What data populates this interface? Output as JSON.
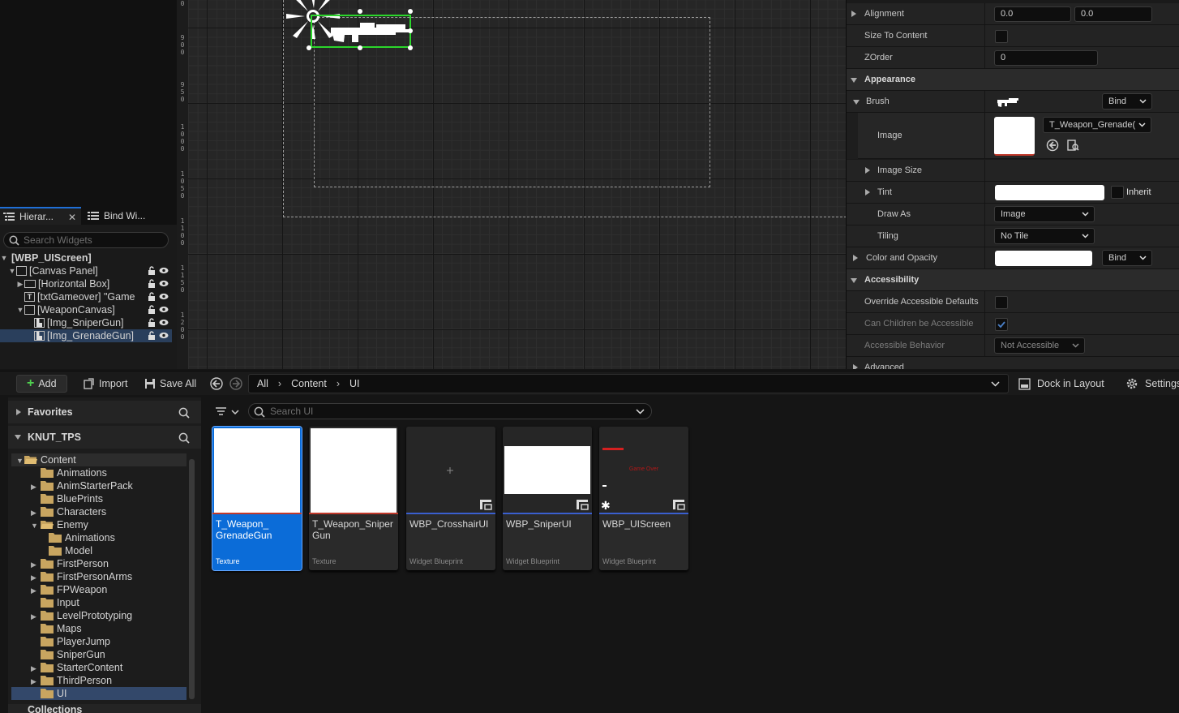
{
  "hierarchy": {
    "tabs": [
      {
        "label": "Hierar..."
      },
      {
        "label": "Bind Wi..."
      }
    ],
    "search_placeholder": "Search Widgets",
    "tree": [
      {
        "label": "[WBP_UIScreen]"
      },
      {
        "label": "[Canvas Panel]"
      },
      {
        "label": "[Horizontal Box]"
      },
      {
        "label": "[txtGameover] \"Game"
      },
      {
        "label": "[WeaponCanvas]"
      },
      {
        "label": "[Img_SniperGun]"
      },
      {
        "label": "[Img_GrenadeGun]"
      }
    ]
  },
  "ruler": {
    "labels": [
      "0",
      "9\n0\n0",
      "9\n5\n0",
      "1\n0\n0\n0",
      "1\n0\n5\n0",
      "1\n1\n0\n0",
      "1\n1\n5\n0",
      "1\n2\n0\n0"
    ]
  },
  "details": {
    "rows": {
      "alignment": {
        "label": "Alignment",
        "x": "0.0",
        "y": "0.0"
      },
      "size_to_content": {
        "label": "Size To Content"
      },
      "zorder": {
        "label": "ZOrder",
        "value": "0"
      },
      "appearance": {
        "label": "Appearance"
      },
      "brush": {
        "label": "Brush",
        "bind": "Bind"
      },
      "image": {
        "label": "Image",
        "value": "T_Weapon_Grenade("
      },
      "image_size": {
        "label": "Image Size"
      },
      "tint": {
        "label": "Tint",
        "inherit": "Inherit"
      },
      "draw_as": {
        "label": "Draw As",
        "value": "Image"
      },
      "tiling": {
        "label": "Tiling",
        "value": "No Tile"
      },
      "color_opacity": {
        "label": "Color and Opacity",
        "bind": "Bind"
      },
      "accessibility": {
        "label": "Accessibility"
      },
      "override_defaults": {
        "label": "Override Accessible Defaults"
      },
      "children_accessible": {
        "label": "Can Children be Accessible"
      },
      "accessible_behavior": {
        "label": "Accessible Behavior",
        "value": "Not Accessible"
      },
      "advanced": {
        "label": "Advanced"
      }
    }
  },
  "toolbar": {
    "add": "Add",
    "import": "Import",
    "save_all": "Save All",
    "breadcrumb": [
      "All",
      "Content",
      "UI"
    ],
    "dock": "Dock in Layout",
    "settings": "Settings"
  },
  "sources": {
    "favorites": "Favorites",
    "project": "KNUT_TPS",
    "collections": "Collections",
    "folders": [
      {
        "label": "Content"
      },
      {
        "label": "Animations"
      },
      {
        "label": "AnimStarterPack"
      },
      {
        "label": "BluePrints"
      },
      {
        "label": "Characters"
      },
      {
        "label": "Enemy"
      },
      {
        "label": "Animations"
      },
      {
        "label": "Model"
      },
      {
        "label": "FirstPerson"
      },
      {
        "label": "FirstPersonArms"
      },
      {
        "label": "FPWeapon"
      },
      {
        "label": "Input"
      },
      {
        "label": "LevelPrototyping"
      },
      {
        "label": "Maps"
      },
      {
        "label": "PlayerJump"
      },
      {
        "label": "SniperGun"
      },
      {
        "label": "StarterContent"
      },
      {
        "label": "ThirdPerson"
      },
      {
        "label": "UI"
      }
    ]
  },
  "assets": {
    "search_placeholder": "Search UI",
    "items": [
      {
        "name": "T_Weapon_\nGrenadeGun",
        "type": "Texture"
      },
      {
        "name": "T_Weapon_Sniper\nGun",
        "type": "Texture"
      },
      {
        "name": "WBP_CrosshairUI",
        "type": "Widget Blueprint"
      },
      {
        "name": "WBP_SniperUI",
        "type": "Widget Blueprint"
      },
      {
        "name": "WBP_UIScreen",
        "type": "Widget Blueprint",
        "thumb_text": "Game Over"
      }
    ]
  },
  "colors": {
    "accent": "#0b6cd8",
    "selection_row": "#2a3f5c",
    "texture_bar": "#c0392b",
    "blueprint_bar": "#3a5fcf",
    "add_plus": "#4fd04f"
  }
}
